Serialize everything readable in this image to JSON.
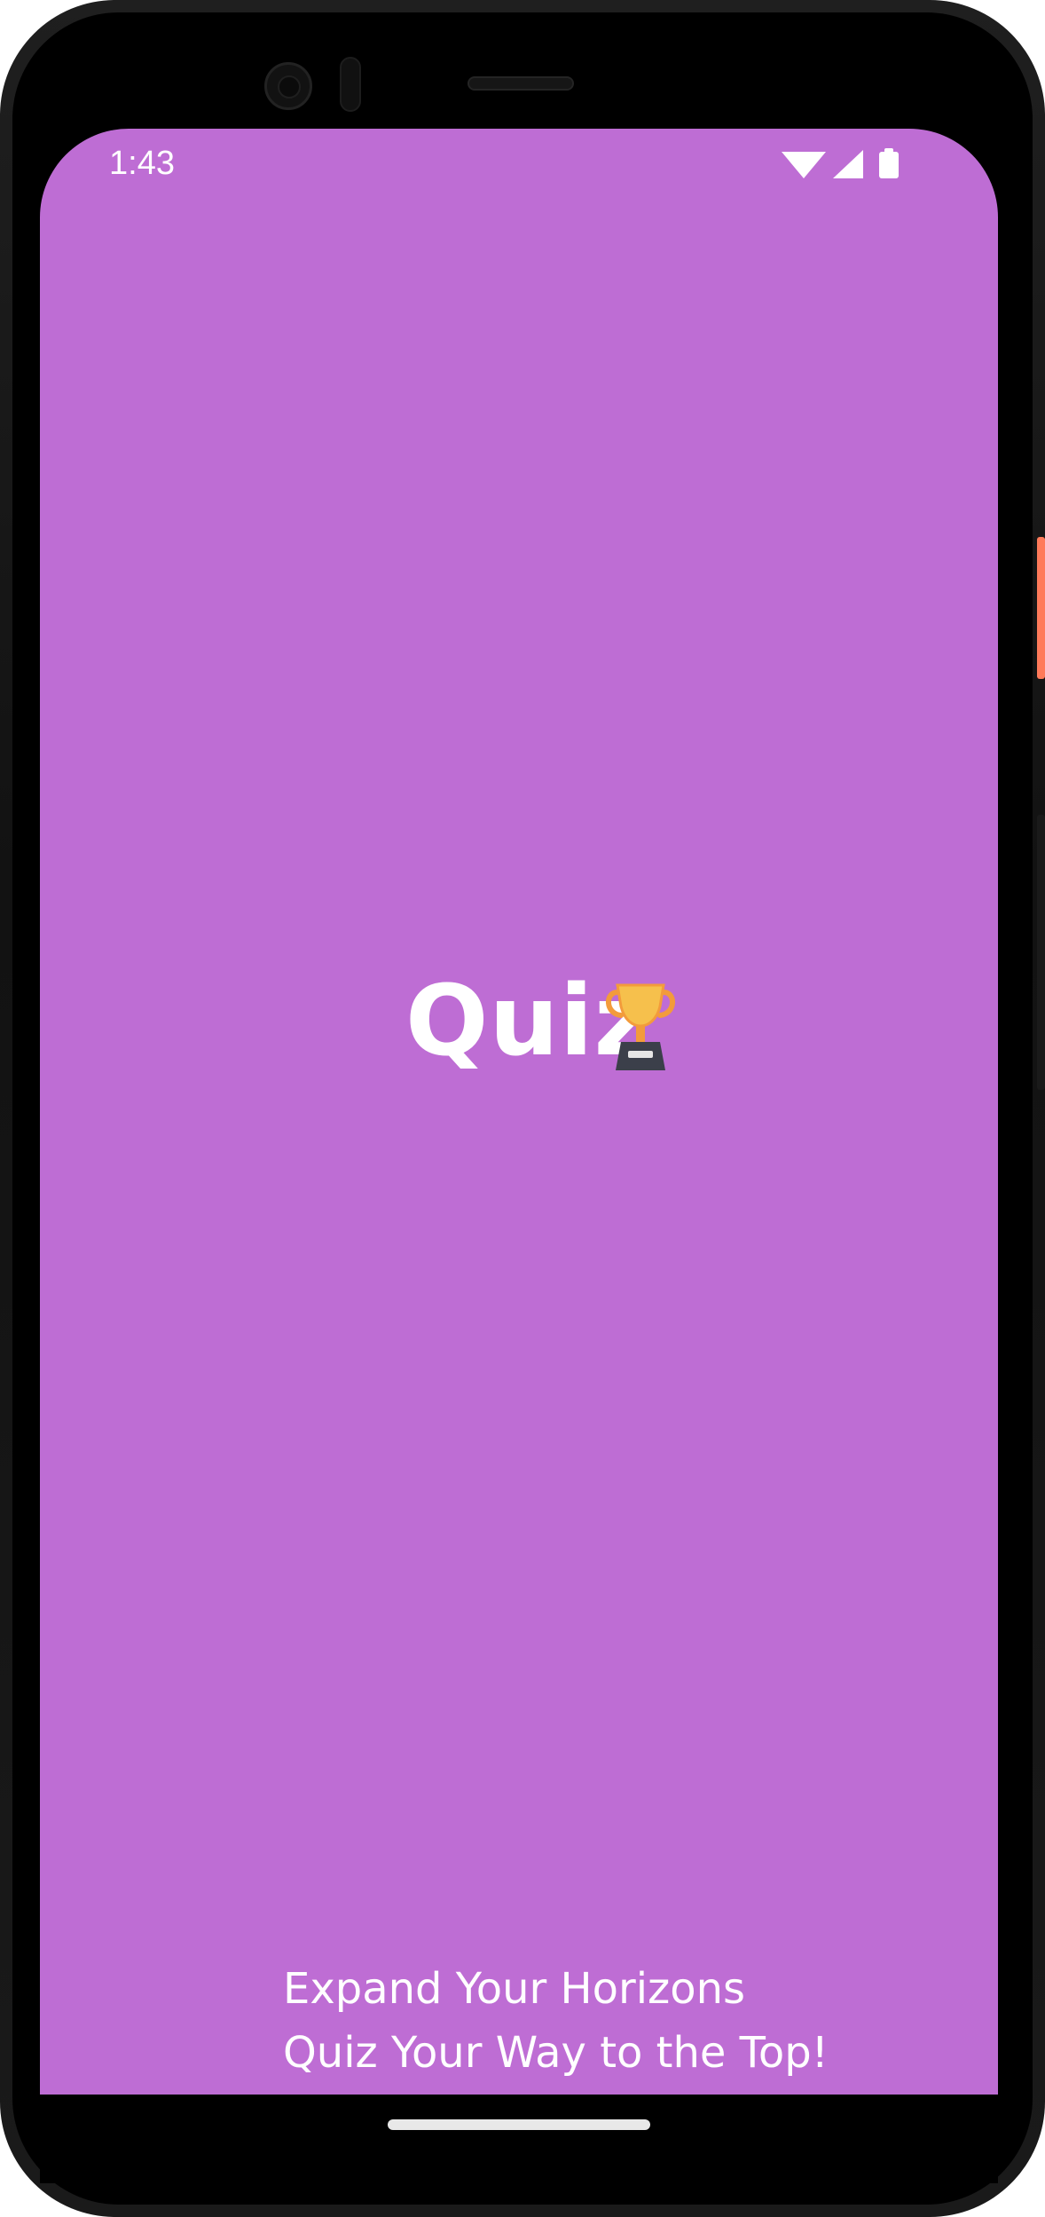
{
  "status_bar": {
    "time": "1:43",
    "icons": [
      "wifi-icon",
      "cellular-signal-icon",
      "battery-icon"
    ]
  },
  "splash": {
    "logo_text": "Quiz",
    "logo_icon": "trophy-icon",
    "tagline_line1": "Expand Your Horizons",
    "tagline_line2": "Quiz Your Way to the Top!"
  },
  "colors": {
    "background": "#be6dd4",
    "text": "#ffffff",
    "trophy_gold": "#f6c04c",
    "trophy_base": "#3b3f4a"
  }
}
